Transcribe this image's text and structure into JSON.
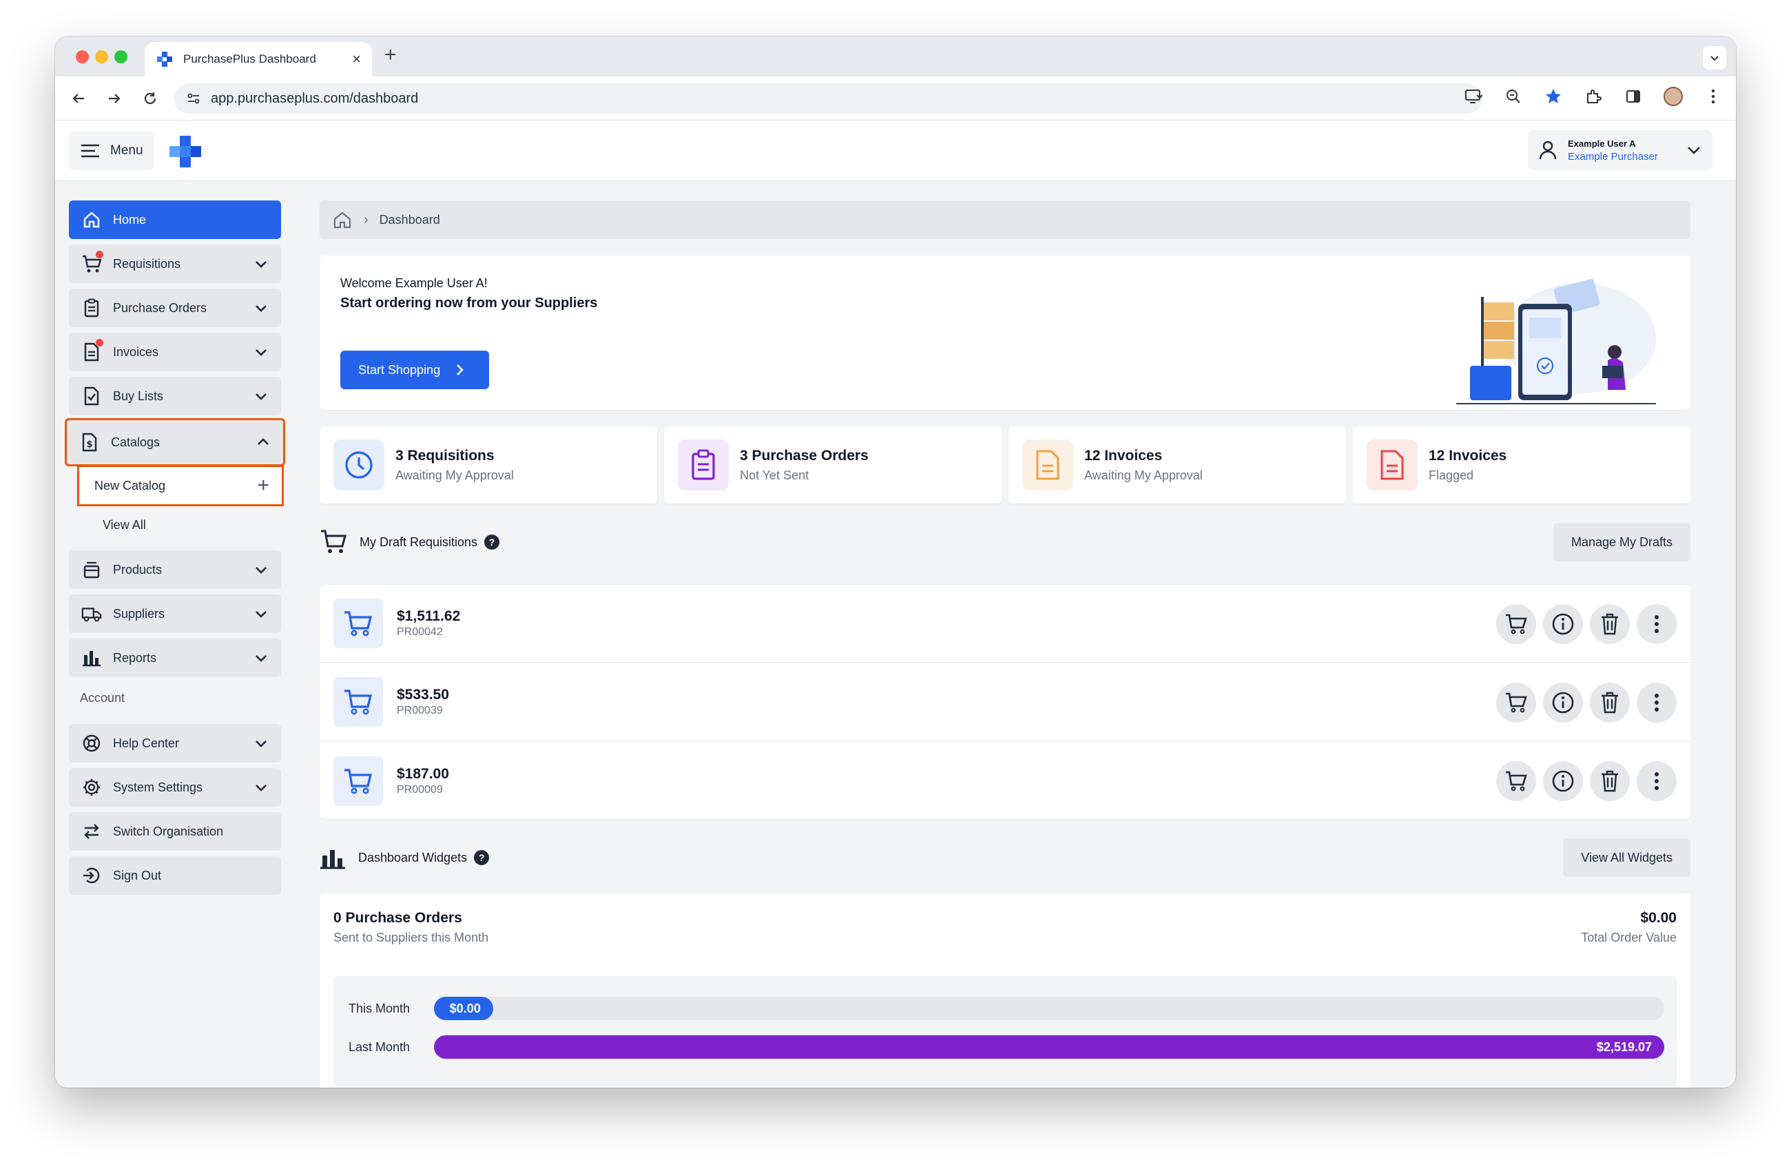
{
  "browser": {
    "tab_title": "PurchasePlus Dashboard",
    "url": "app.purchaseplus.com/dashboard"
  },
  "header": {
    "menu_label": "Menu",
    "user_name": "Example User A",
    "user_role": "Example Purchaser"
  },
  "sidebar": {
    "home": "Home",
    "requisitions": "Requisitions",
    "purchase_orders": "Purchase Orders",
    "invoices": "Invoices",
    "buy_lists": "Buy Lists",
    "catalogs": "Catalogs",
    "new_catalog": "New Catalog",
    "view_all": "View All",
    "products": "Products",
    "suppliers": "Suppliers",
    "reports": "Reports",
    "account_section": "Account",
    "help_center": "Help Center",
    "system_settings": "System Settings",
    "switch_organisation": "Switch Organisation",
    "sign_out": "Sign Out"
  },
  "breadcrumb": {
    "current": "Dashboard"
  },
  "welcome": {
    "greeting": "Welcome Example User A!",
    "headline": "Start ordering now from your Suppliers",
    "cta": "Start Shopping"
  },
  "stats": [
    {
      "title": "3 Requisitions",
      "subtitle": "Awaiting My Approval",
      "color": "#2563eb"
    },
    {
      "title": "3 Purchase Orders",
      "subtitle": "Not Yet Sent",
      "color": "#7e22ce"
    },
    {
      "title": "12 Invoices",
      "subtitle": "Awaiting My Approval",
      "color": "#f59e42"
    },
    {
      "title": "12 Invoices",
      "subtitle": "Flagged",
      "color": "#ef4444"
    }
  ],
  "drafts": {
    "title": "My Draft Requisitions",
    "manage_button": "Manage My Drafts",
    "rows": [
      {
        "amount": "$1,511.62",
        "ref": "PR00042"
      },
      {
        "amount": "$533.50",
        "ref": "PR00039"
      },
      {
        "amount": "$187.00",
        "ref": "PR00009"
      }
    ]
  },
  "widgets": {
    "title": "Dashboard Widgets",
    "view_all_button": "View All Widgets",
    "po_count": "0 Purchase Orders",
    "po_caption": "Sent to Suppliers this Month",
    "total_value": "$0.00",
    "total_caption": "Total Order Value",
    "this_month_label": "This Month",
    "this_month_value": "$0.00",
    "this_month_fraction": 0.048,
    "last_month_label": "Last Month",
    "last_month_value": "$2,519.07",
    "last_month_fraction": 1.0
  },
  "colors": {
    "accent": "#2563eb",
    "purple": "#7e22ce",
    "highlight": "#ea580c"
  }
}
